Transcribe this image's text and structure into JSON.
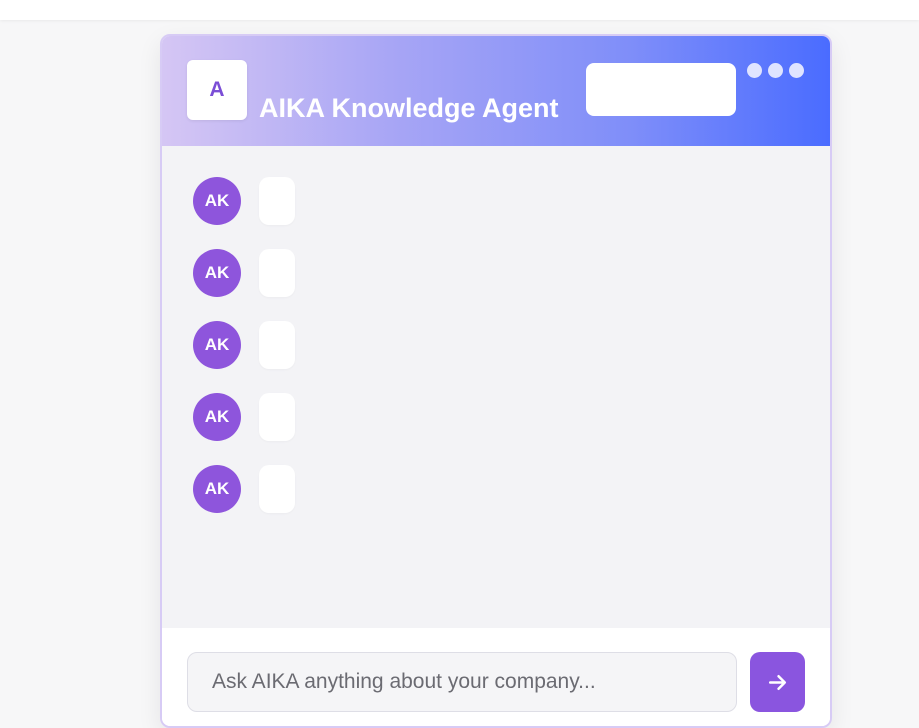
{
  "app": {
    "logo_letter": "A",
    "title": "AIKA Knowledge Agent"
  },
  "icons": {
    "more": "more-dots-icon",
    "send": "arrow-right-icon"
  },
  "colors": {
    "header_start": "#d5c6f4",
    "header_end": "#4a6cff",
    "accent": "#8a55df",
    "avatar": "#8e55dc",
    "message_background": "#f3f3f6"
  },
  "messages": [
    {
      "avatar_text": "AK",
      "text": ""
    },
    {
      "avatar_text": "AK",
      "text": ""
    },
    {
      "avatar_text": "AK",
      "text": ""
    },
    {
      "avatar_text": "AK",
      "text": ""
    },
    {
      "avatar_text": "AK",
      "text": ""
    }
  ],
  "composer": {
    "placeholder": "Ask AIKA anything about your company...",
    "value": ""
  }
}
